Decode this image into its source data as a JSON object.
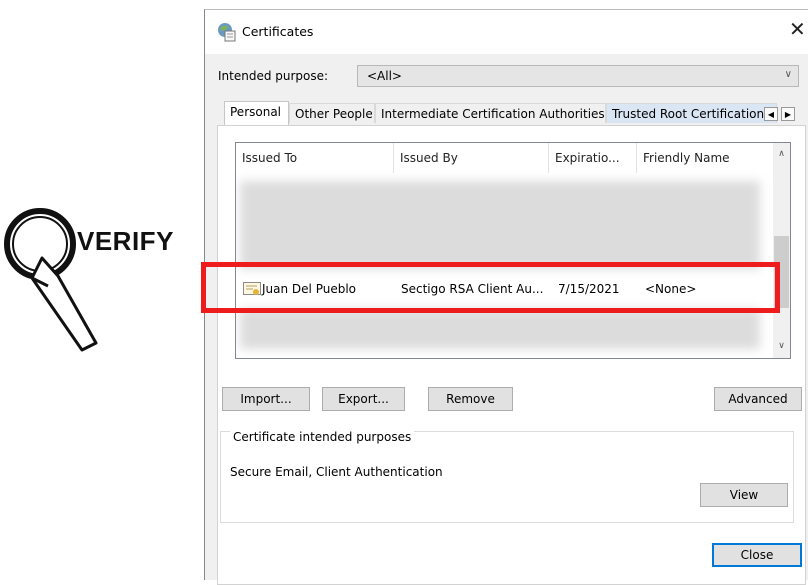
{
  "annotation": {
    "label": "VERIFY"
  },
  "window": {
    "title": "Certificates",
    "close_symbol": "✕"
  },
  "intended_purpose": {
    "label": "Intended purpose:",
    "value": "<All>"
  },
  "tabs": [
    {
      "label": "Personal",
      "active": true
    },
    {
      "label": "Other People"
    },
    {
      "label": "Intermediate Certification Authorities"
    },
    {
      "label": "Trusted Root Certification"
    }
  ],
  "table": {
    "columns": [
      "Issued To",
      "Issued By",
      "Expiratio...",
      "Friendly Name"
    ],
    "rows": [
      {
        "issued_to": "Juan Del Pueblo",
        "issued_by": "Sectigo RSA Client Au...",
        "expiration": "7/15/2021",
        "friendly_name": "<None>",
        "icon": "certificate-icon"
      }
    ]
  },
  "buttons": {
    "import": "Import...",
    "export": "Export...",
    "remove": "Remove",
    "advanced": "Advanced",
    "view": "View",
    "close": "Close"
  },
  "purposes_group": {
    "label": "Certificate intended purposes",
    "value": "Secure Email, Client Authentication"
  },
  "colors": {
    "highlight": "#ee1c1c",
    "default_button_border": "#0078d7"
  }
}
